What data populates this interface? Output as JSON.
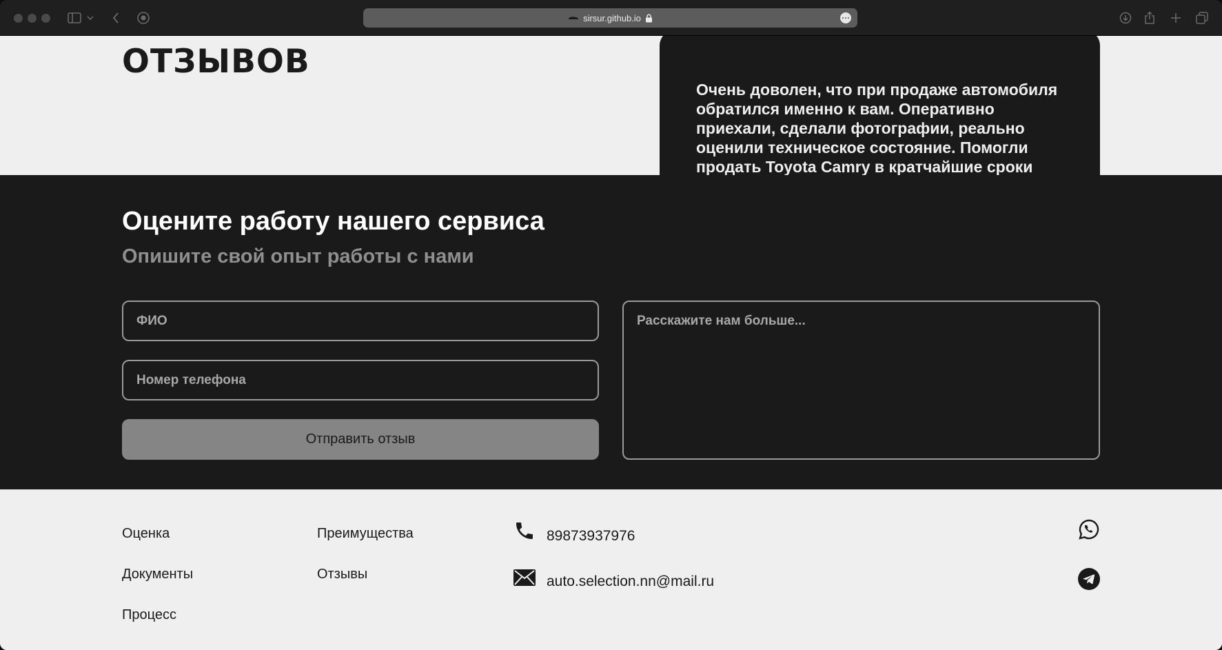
{
  "browser": {
    "url": "sirsur.github.io"
  },
  "reviews": {
    "title": "ОТЗЫВОВ",
    "review_text": "Очень доволен, что при продаже автомобиля обратился именно к вам. Оперативно приехали, сделали фотографии, реально оценили техническое состояние. Помогли продать Toyota Camry в кратчайшие сроки"
  },
  "feedback": {
    "title": "Оцените работу нашего сервиса",
    "subtitle": "Опишите свой опыт работы с нами",
    "name_placeholder": "ФИО",
    "phone_placeholder": "Номер телефона",
    "message_placeholder": "Расскажите нам больше...",
    "submit_label": "Отправить отзыв"
  },
  "footer": {
    "nav_col1": [
      "Оценка",
      "Документы",
      "Процесс"
    ],
    "nav_col2": [
      "Преимущества",
      "Отзывы"
    ],
    "phone": "89873937976",
    "email": "auto.selection.nn@mail.ru"
  },
  "colors": {
    "dark": "#1a1a1a",
    "light": "#efefef",
    "muted": "#8f8f8f",
    "button": "#858585"
  },
  "icons": [
    "sidebar-icon",
    "back-icon",
    "privacy-icon",
    "lock-icon",
    "download-icon",
    "share-icon",
    "new-tab-icon",
    "tabs-overview-icon",
    "phone-icon",
    "mail-icon",
    "whatsapp-icon",
    "telegram-icon"
  ]
}
